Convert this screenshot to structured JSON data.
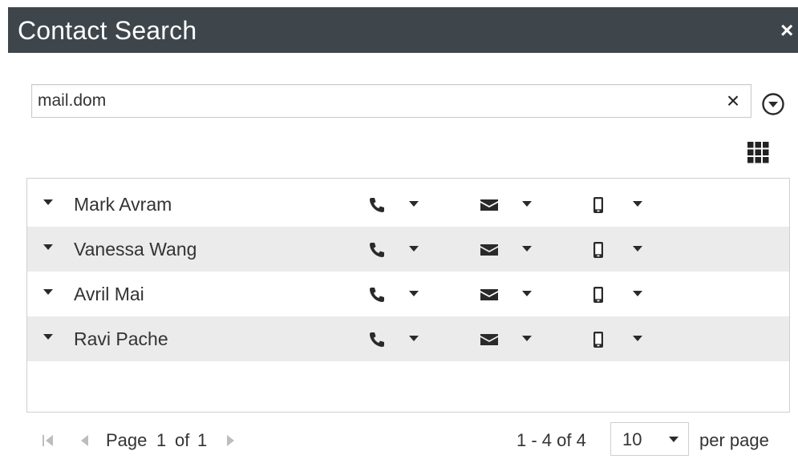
{
  "dialog": {
    "title": "Contact Search",
    "close_label": "×"
  },
  "search": {
    "value": "mail.dom",
    "clear_label": "×"
  },
  "icons": {
    "close": "close-icon",
    "clear": "clear-icon",
    "options": "chevron-circle-down-icon",
    "grid_view": "grid-view-icon",
    "row_expand": "caret-down-icon",
    "phone": "phone-icon",
    "email": "envelope-icon",
    "mobile": "mobile-phone-icon",
    "dropdown": "caret-down-icon",
    "first_page": "first-page-icon",
    "prev_page": "prev-page-icon",
    "next_page": "next-page-icon"
  },
  "contacts": [
    {
      "name": "Mark Avram"
    },
    {
      "name": "Vanessa Wang"
    },
    {
      "name": "Avril Mai"
    },
    {
      "name": "Ravi Pache"
    }
  ],
  "pagination": {
    "page_word": "Page",
    "current_page": "1",
    "of_word": "of",
    "total_pages": "1",
    "range_text": "1 - 4 of 4",
    "per_page_value": "10",
    "per_page_label": "per page"
  },
  "colors": {
    "titlebar_bg": "#3e464c",
    "row_alt_bg": "#ebebeb",
    "icon_dark": "#2a2a2a",
    "pager_icon": "#bdbdbd"
  }
}
